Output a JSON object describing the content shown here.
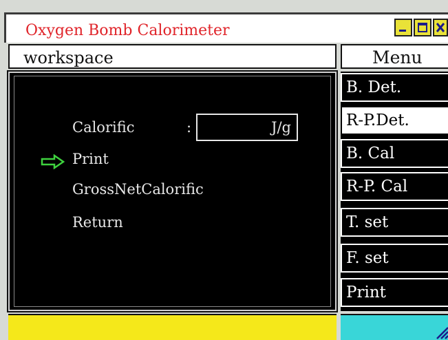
{
  "window": {
    "title": "Oxygen Bomb Calorimeter",
    "controls": [
      "minimize-icon",
      "maximize-icon",
      "close-icon"
    ]
  },
  "workspace": {
    "header": "workspace",
    "calorific_label": "Calorific",
    "calorific_colon": ":",
    "calorific_value": "",
    "calorific_unit": "J/g",
    "options": [
      {
        "label": "Print",
        "selected": true
      },
      {
        "label": "GrossNetCalorific",
        "selected": false
      },
      {
        "label": "Return",
        "selected": false
      }
    ],
    "selection_icon": "right-arrow-icon"
  },
  "menu": {
    "header": "Menu",
    "items": [
      {
        "label": "B. Det.",
        "selected": false
      },
      {
        "label": "R-P.Det.",
        "selected": true
      },
      {
        "label": "B. Cal",
        "selected": false
      },
      {
        "label": "R-P. Cal",
        "selected": false
      },
      {
        "label": "T. set",
        "selected": false
      },
      {
        "label": "F. set",
        "selected": false
      },
      {
        "label": "Print",
        "selected": false
      }
    ]
  },
  "colors": {
    "title_text": "#e0242a",
    "arrow": "#3ed23e",
    "status_left": "#f5e81a",
    "status_right": "#39d6d8",
    "window_buttons": "#e9e238"
  }
}
